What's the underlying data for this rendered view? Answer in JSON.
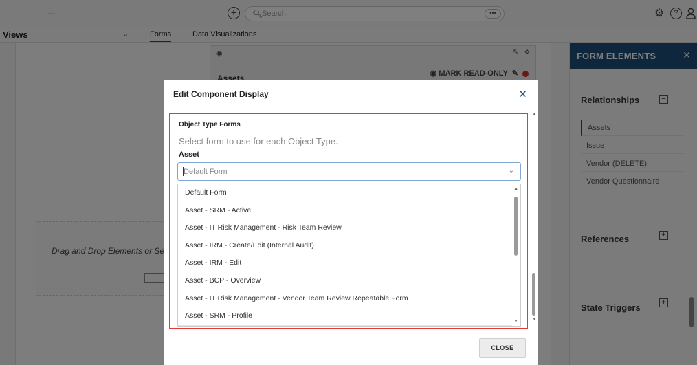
{
  "topbar": {
    "faint_text": "—  ·",
    "search_placeholder": "Search...",
    "more_label": "•••"
  },
  "views": {
    "label": "Views",
    "tabs": [
      {
        "label": "Forms",
        "active": true
      },
      {
        "label": "Data Visualizations",
        "active": false
      }
    ]
  },
  "background": {
    "component_title": "Assets",
    "mark_read_only": "MARK READ-ONLY",
    "drag_text": "Drag and Drop Elements or Se"
  },
  "panel": {
    "title": "FORM ELEMENTS",
    "sections": [
      {
        "title": "Relationships",
        "toggle": "−",
        "items": [
          "Assets",
          "Issue",
          "Vendor (DELETE)",
          "Vendor Questionnaire"
        ]
      },
      {
        "title": "References",
        "toggle": "+"
      },
      {
        "title": "State Triggers",
        "toggle": "+"
      }
    ]
  },
  "modal": {
    "title": "Edit Component Display",
    "section_heading": "Object Type Forms",
    "helper_text": "Select form to use for each Object Type.",
    "field_label": "Asset",
    "select_value": "Default Form",
    "options": [
      "Default Form",
      "Asset - SRM - Active",
      "Asset - IT Risk Management - Risk Team Review",
      "Asset - IRM - Create/Edit (Internal Audit)",
      "Asset - IRM - Edit",
      "Asset - BCP - Overview",
      "Asset - IT Risk Management - Vendor Team Review Repeatable Form",
      "Asset - SRM - Profile",
      ""
    ],
    "close_label": "CLOSE"
  },
  "colors": {
    "accent": "#1f4e79",
    "highlight_border": "#e53935"
  }
}
